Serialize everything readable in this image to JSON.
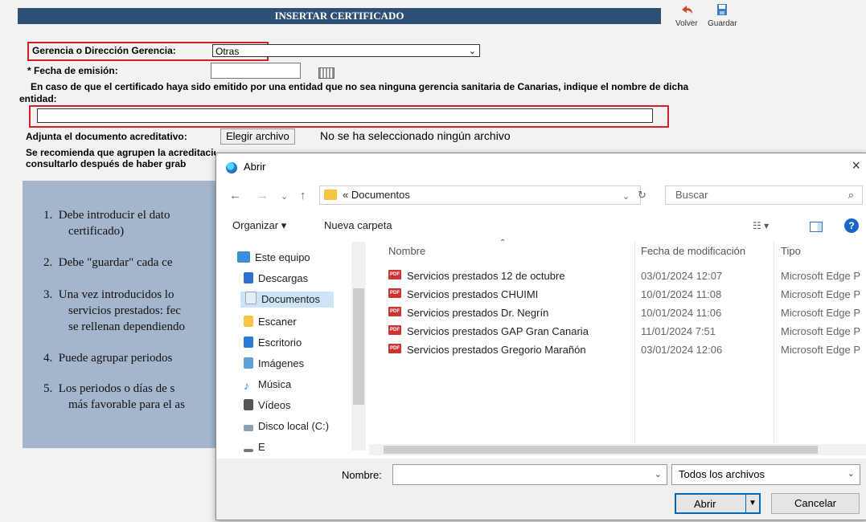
{
  "form": {
    "title": "INSERTAR CERTIFICADO",
    "actions": {
      "volver": "Volver",
      "guardar": "Guardar"
    },
    "gerencia_label": "Gerencia o Dirección Gerencia:",
    "gerencia_value": "Otras",
    "fecha_label": "* Fecha de emisión:",
    "entidad_label_1": "En caso de que el certificado haya sido emitido por una entidad que no sea ninguna gerencia sanitaria de Canarias, indique el nombre de dicha",
    "entidad_label_2": "entidad:",
    "adjunta_label": "Adjunta el documento acreditativo:",
    "file_button": "Elegir archivo",
    "no_file_text": "No se ha seleccionado ningún archivo",
    "recommend_1": "Se recomienda que agrupen la acreditación de \"cada mérito\" en un único documento. Una vez seleccionado el documento acreditativo, podrá",
    "recommend_2": "consultarlo después de haber grab",
    "list": [
      {
        "n": "1.",
        "line1": "Debe introducir el dato",
        "line2": "certificado)"
      },
      {
        "n": "2.",
        "line1": "Debe \"guardar\" cada ce",
        "line2": ""
      },
      {
        "n": "3.",
        "line1": "Una vez introducidos lo",
        "line2": "servicios prestados: fec",
        "line3": "se rellenan dependiendo"
      },
      {
        "n": "4.",
        "line1": "Puede agrupar periodos",
        "line2": ""
      },
      {
        "n": "5.",
        "line1": "Los periodos o días de s",
        "line2": "más favorable para el as"
      }
    ]
  },
  "dialog": {
    "title": "Abrir",
    "close": "×",
    "breadcrumb": "« Documentos",
    "search_placeholder": "Buscar",
    "toolbar": {
      "organizar": "Organizar ▾",
      "nueva_carpeta": "Nueva carpeta"
    },
    "nav_items": [
      "Este equipo",
      "Descargas",
      "Documentos",
      "Escaner",
      "Escritorio",
      "Imágenes",
      "Música",
      "Vídeos",
      "Disco local (C:)",
      "E"
    ],
    "columns": {
      "nombre": "Nombre",
      "fecha": "Fecha de modificación",
      "tipo": "Tipo"
    },
    "files": [
      {
        "name": "Servicios prestados 12 de octubre",
        "date": "03/01/2024 12:07",
        "type": "Microsoft Edge P"
      },
      {
        "name": "Servicios prestados CHUIMI",
        "date": "10/01/2024 11:08",
        "type": "Microsoft Edge P"
      },
      {
        "name": "Servicios prestados Dr. Negrín",
        "date": "10/01/2024 11:06",
        "type": "Microsoft Edge P"
      },
      {
        "name": "Servicios prestados GAP Gran Canaria",
        "date": "11/01/2024 7:51",
        "type": "Microsoft Edge P"
      },
      {
        "name": "Servicios prestados Gregorio Marañón",
        "date": "03/01/2024 12:06",
        "type": "Microsoft Edge P"
      }
    ],
    "nombre_label": "Nombre:",
    "file_type": "Todos los archivos",
    "open_button": "Abrir",
    "cancel_button": "Cancelar"
  }
}
